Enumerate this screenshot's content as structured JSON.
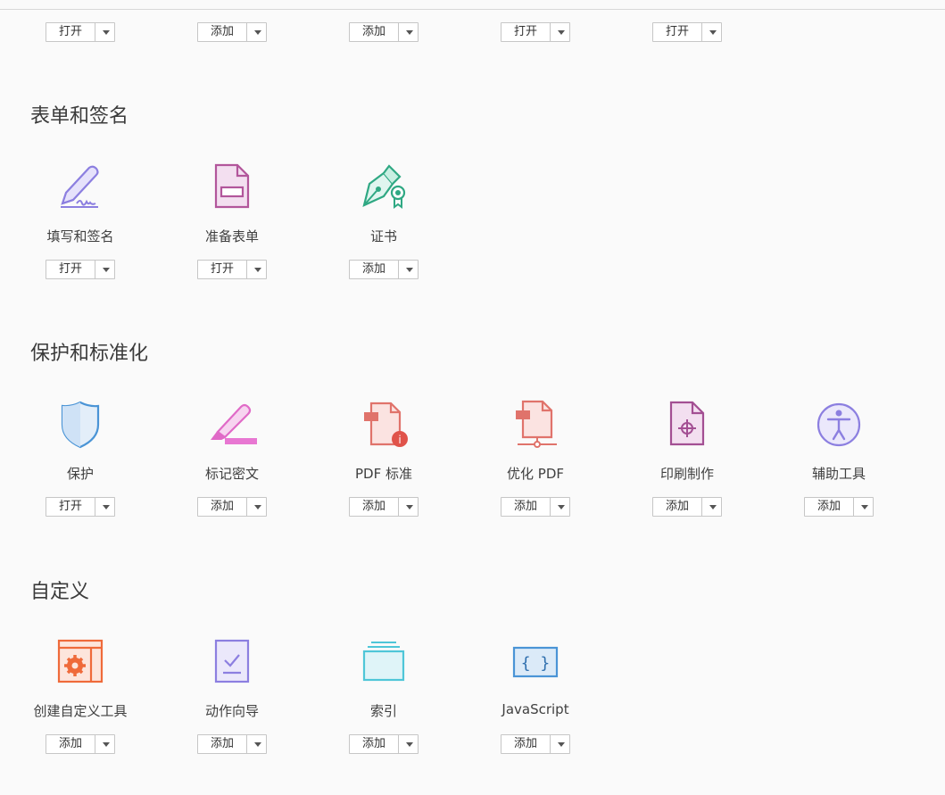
{
  "top_row": {
    "buttons": [
      "打开",
      "添加",
      "添加",
      "打开",
      "打开"
    ]
  },
  "sections": [
    {
      "title": "表单和签名",
      "tools": [
        {
          "name": "填写和签名",
          "icon": "fill-sign-icon",
          "button": "打开"
        },
        {
          "name": "准备表单",
          "icon": "prepare-form-icon",
          "button": "打开"
        },
        {
          "name": "证书",
          "icon": "certificate-icon",
          "button": "添加"
        }
      ]
    },
    {
      "title": "保护和标准化",
      "tools": [
        {
          "name": "保护",
          "icon": "shield-icon",
          "button": "打开"
        },
        {
          "name": "标记密文",
          "icon": "redact-icon",
          "button": "添加"
        },
        {
          "name": "PDF 标准",
          "icon": "pdf-standards-icon",
          "button": "添加"
        },
        {
          "name": "优化 PDF",
          "icon": "optimize-pdf-icon",
          "button": "添加"
        },
        {
          "name": "印刷制作",
          "icon": "print-production-icon",
          "button": "添加"
        },
        {
          "name": "辅助工具",
          "icon": "accessibility-icon",
          "button": "添加"
        }
      ]
    },
    {
      "title": "自定义",
      "tools": [
        {
          "name": "创建自定义工具",
          "icon": "custom-tool-icon",
          "button": "添加"
        },
        {
          "name": "动作向导",
          "icon": "action-wizard-icon",
          "button": "添加"
        },
        {
          "name": "索引",
          "icon": "index-icon",
          "button": "添加"
        },
        {
          "name": "JavaScript",
          "icon": "javascript-icon",
          "button": "添加"
        }
      ]
    }
  ]
}
